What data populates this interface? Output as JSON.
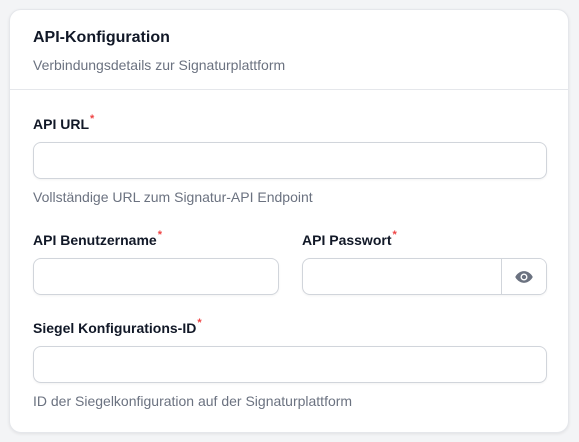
{
  "card": {
    "title": "API-Konfiguration",
    "description": "Verbindungsdetails zur Signaturplattform"
  },
  "fields": {
    "api_url": {
      "label": "API URL",
      "required_marker": "*",
      "value": "",
      "hint": "Vollständige URL zum Signatur-API Endpoint"
    },
    "api_username": {
      "label": "API Benutzername",
      "required_marker": "*",
      "value": ""
    },
    "api_password": {
      "label": "API Passwort",
      "required_marker": "*",
      "value": "",
      "toggle_icon": "eye-icon"
    },
    "seal_config_id": {
      "label": "Siegel Konfigurations-ID",
      "required_marker": "*",
      "value": "",
      "hint": "ID der Siegelkonfiguration auf der Signaturplattform"
    }
  },
  "colors": {
    "required": "#ef4444",
    "border": "#d1d5db",
    "muted_text": "#6b7280",
    "icon": "#6b7280"
  }
}
